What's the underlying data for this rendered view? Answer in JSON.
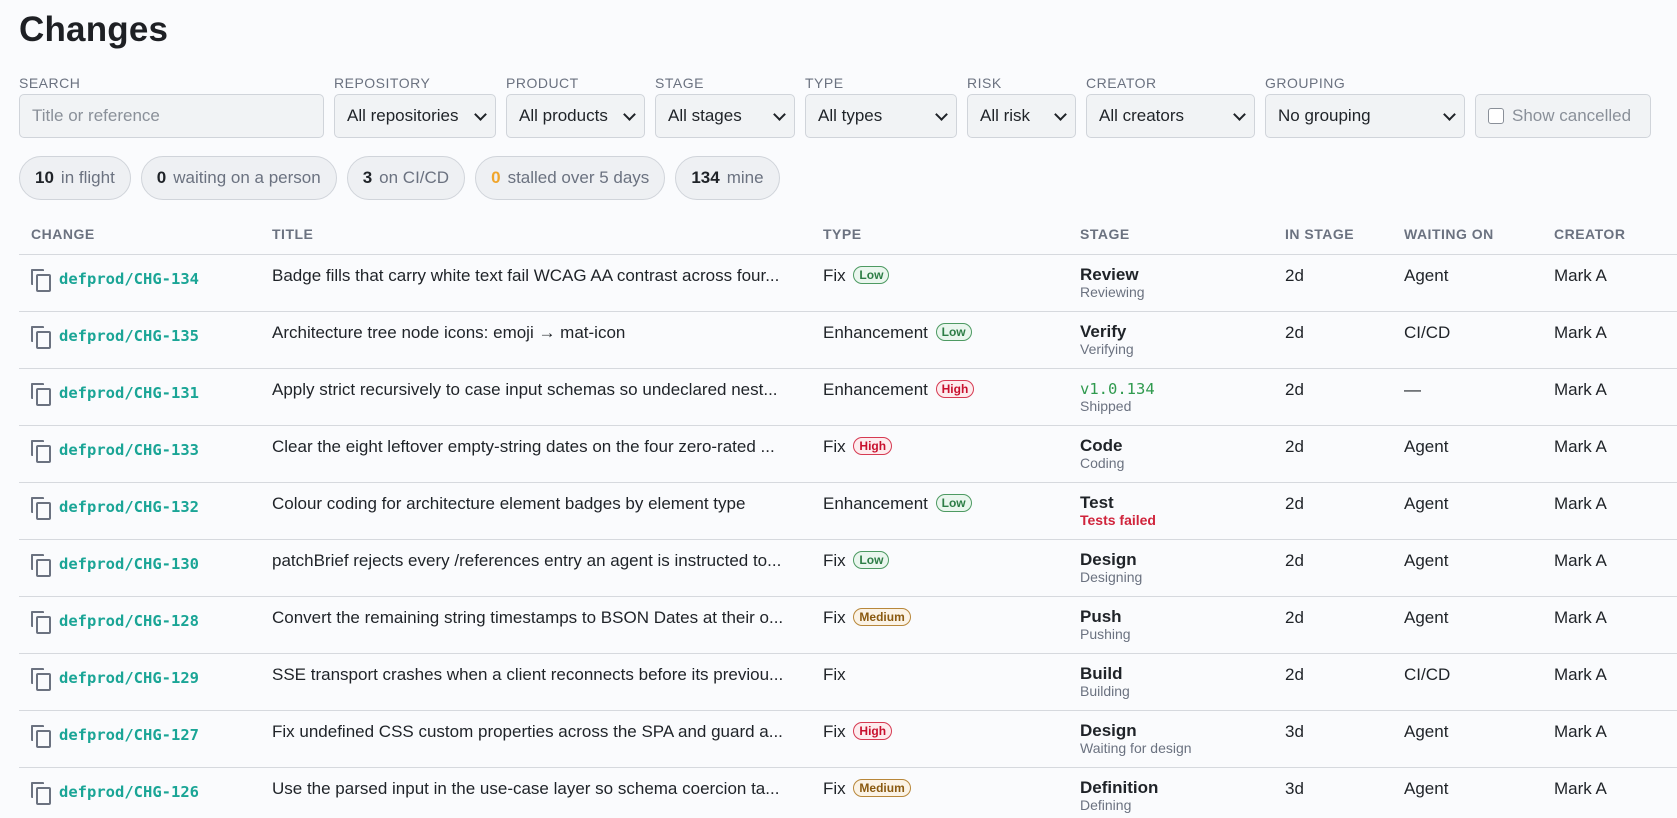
{
  "page": {
    "title": "Changes"
  },
  "filters": {
    "search": {
      "label": "SEARCH",
      "placeholder": "Title or reference"
    },
    "repository": {
      "label": "REPOSITORY",
      "value": "All repositories"
    },
    "product": {
      "label": "PRODUCT",
      "value": "All products"
    },
    "stage": {
      "label": "STAGE",
      "value": "All stages"
    },
    "type": {
      "label": "TYPE",
      "value": "All types"
    },
    "risk": {
      "label": "RISK",
      "value": "All risk"
    },
    "creator": {
      "label": "CREATOR",
      "value": "All creators"
    },
    "grouping": {
      "label": "GROUPING",
      "value": "No grouping"
    },
    "show_cancelled": {
      "label": "Show cancelled",
      "checked": false
    }
  },
  "summary": [
    {
      "count": "10",
      "label": "in flight"
    },
    {
      "count": "0",
      "label": "waiting on a person"
    },
    {
      "count": "3",
      "label": "on CI/CD"
    },
    {
      "count": "0",
      "label": "stalled over 5 days",
      "warn": true
    },
    {
      "count": "134",
      "label": "mine"
    }
  ],
  "table": {
    "headers": {
      "change": "CHANGE",
      "title": "TITLE",
      "type": "TYPE",
      "stage": "STAGE",
      "in_stage": "IN STAGE",
      "waiting_on": "WAITING ON",
      "creator": "CREATOR"
    },
    "rows": [
      {
        "ref": "defprod/CHG-134",
        "title": "Badge fills that carry white text fail WCAG AA contrast across four...",
        "type": "Fix",
        "risk": "Low",
        "stage": "Review",
        "stage_sub": "Reviewing",
        "in_stage": "2d",
        "waiting_on": "Agent",
        "creator": "Mark A"
      },
      {
        "ref": "defprod/CHG-135",
        "title": "Architecture tree node icons: emoji → mat-icon",
        "type": "Enhancement",
        "risk": "Low",
        "stage": "Verify",
        "stage_sub": "Verifying",
        "in_stage": "2d",
        "waiting_on": "CI/CD",
        "creator": "Mark A"
      },
      {
        "ref": "defprod/CHG-131",
        "title": "Apply strict recursively to case input schemas so undeclared nest...",
        "type": "Enhancement",
        "risk": "High",
        "stage": "v1.0.134",
        "stage_version": true,
        "stage_sub": "Shipped",
        "in_stage": "2d",
        "waiting_on": "—",
        "creator": "Mark A"
      },
      {
        "ref": "defprod/CHG-133",
        "title": "Clear the eight leftover empty-string dates on the four zero-rated ...",
        "type": "Fix",
        "risk": "High",
        "stage": "Code",
        "stage_sub": "Coding",
        "in_stage": "2d",
        "waiting_on": "Agent",
        "creator": "Mark A"
      },
      {
        "ref": "defprod/CHG-132",
        "title": "Colour coding for architecture element badges by element type",
        "type": "Enhancement",
        "risk": "Low",
        "stage": "Test",
        "stage_sub": "Tests failed",
        "stage_failed": true,
        "in_stage": "2d",
        "waiting_on": "Agent",
        "creator": "Mark A"
      },
      {
        "ref": "defprod/CHG-130",
        "title": "patchBrief rejects every /references entry an agent is instructed to...",
        "type": "Fix",
        "risk": "Low",
        "stage": "Design",
        "stage_sub": "Designing",
        "in_stage": "2d",
        "waiting_on": "Agent",
        "creator": "Mark A"
      },
      {
        "ref": "defprod/CHG-128",
        "title": "Convert the remaining string timestamps to BSON Dates at their o...",
        "type": "Fix",
        "risk": "Medium",
        "stage": "Push",
        "stage_sub": "Pushing",
        "in_stage": "2d",
        "waiting_on": "Agent",
        "creator": "Mark A"
      },
      {
        "ref": "defprod/CHG-129",
        "title": "SSE transport crashes when a client reconnects before its previou...",
        "type": "Fix",
        "risk": "",
        "stage": "Build",
        "stage_sub": "Building",
        "in_stage": "2d",
        "waiting_on": "CI/CD",
        "creator": "Mark A"
      },
      {
        "ref": "defprod/CHG-127",
        "title": "Fix undefined CSS custom properties across the SPA and guard a...",
        "type": "Fix",
        "risk": "High",
        "stage": "Design",
        "stage_sub": "Waiting for design",
        "in_stage": "3d",
        "waiting_on": "Agent",
        "creator": "Mark A"
      },
      {
        "ref": "defprod/CHG-126",
        "title": "Use the parsed input in the use-case layer so schema coercion ta...",
        "type": "Fix",
        "risk": "Medium",
        "stage": "Definition",
        "stage_sub": "Defining",
        "in_stage": "3d",
        "waiting_on": "Agent",
        "creator": "Mark A"
      }
    ]
  }
}
